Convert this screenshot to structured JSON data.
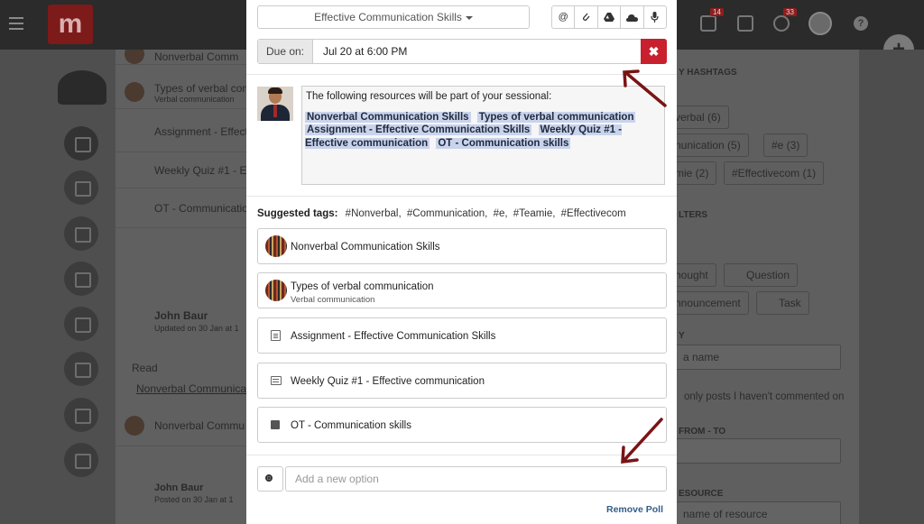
{
  "modal": {
    "resource_select": "Effective Communication Skills",
    "toolbar_icons": [
      "at-icon",
      "paperclip-icon",
      "google-drive-icon",
      "onedrive-icon",
      "microphone-icon"
    ],
    "toolbar_glyphs": [
      "@",
      "⌇",
      "▲",
      "☁",
      "🎙"
    ],
    "due_label": "Due on:",
    "due_value": "Jul 20 at 6:00 PM",
    "due_clear_glyph": "✖",
    "message_intro": "The following resources will be part of your sessional:",
    "message_tags": [
      "Nonverbal Communication Skills",
      "Types of verbal communication",
      "Assignment - Effective Communication Skills",
      "Weekly Quiz #1 - Effective communication",
      "OT - Communication skills"
    ],
    "suggested_label": "Suggested tags:",
    "suggested_tags": [
      "#Nonverbal,",
      "#Communication,",
      "#e,",
      "#Teamie,",
      "#Effectivecom"
    ],
    "resources": [
      {
        "title": "Nonverbal Communication Skills",
        "subtitle": "",
        "icon": "course-thumbnail"
      },
      {
        "title": "Types of verbal communication",
        "subtitle": "Verbal communication",
        "icon": "course-thumbnail"
      },
      {
        "title": "Assignment - Effective Communication Skills",
        "subtitle": "",
        "icon": "document-icon"
      },
      {
        "title": "Weekly Quiz #1 - Effective communication",
        "subtitle": "",
        "icon": "quiz-icon"
      },
      {
        "title": "OT - Communication skills",
        "subtitle": "",
        "icon": "ot-icon"
      }
    ],
    "option_placeholder": "Add a new option",
    "remove_poll": "Remove Poll"
  },
  "background": {
    "top_badges": [
      "14",
      "33"
    ],
    "feed": [
      "Nonverbal Comm",
      "Types of verbal com",
      "Verbal communication",
      "Assignment - Effect",
      "Weekly Quiz #1 - E",
      "OT - Communicatio",
      "John Baur",
      "Updated on 30 Jan at 1",
      "Read",
      "Nonverbal Communicati",
      "Nonverbal Commu",
      "John Baur",
      "Posted on 30 Jan at 1"
    ],
    "right_panel": {
      "hashtags_heading": "Y HASHTAGS",
      "filters_heading": "LTERS",
      "hashtags": [
        "verbal (6)",
        "nunication (5)",
        "#e (3)",
        "mie (2)",
        "#Effectivecom (1)"
      ],
      "filter_chips": [
        "hought",
        "Question",
        "nnouncement",
        "Task"
      ],
      "by_label": "Y",
      "name_placeholder": "a name",
      "only_posts": "only posts I haven't commented on",
      "from_to": "FROM - TO",
      "resource_label": "ESOURCE",
      "resource_placeholder": "name of resource"
    }
  },
  "colors": {
    "danger": "#c8202f",
    "tag_bg": "#c9d3ec",
    "link": "#2f5d8a",
    "arrow": "#7a1414"
  }
}
